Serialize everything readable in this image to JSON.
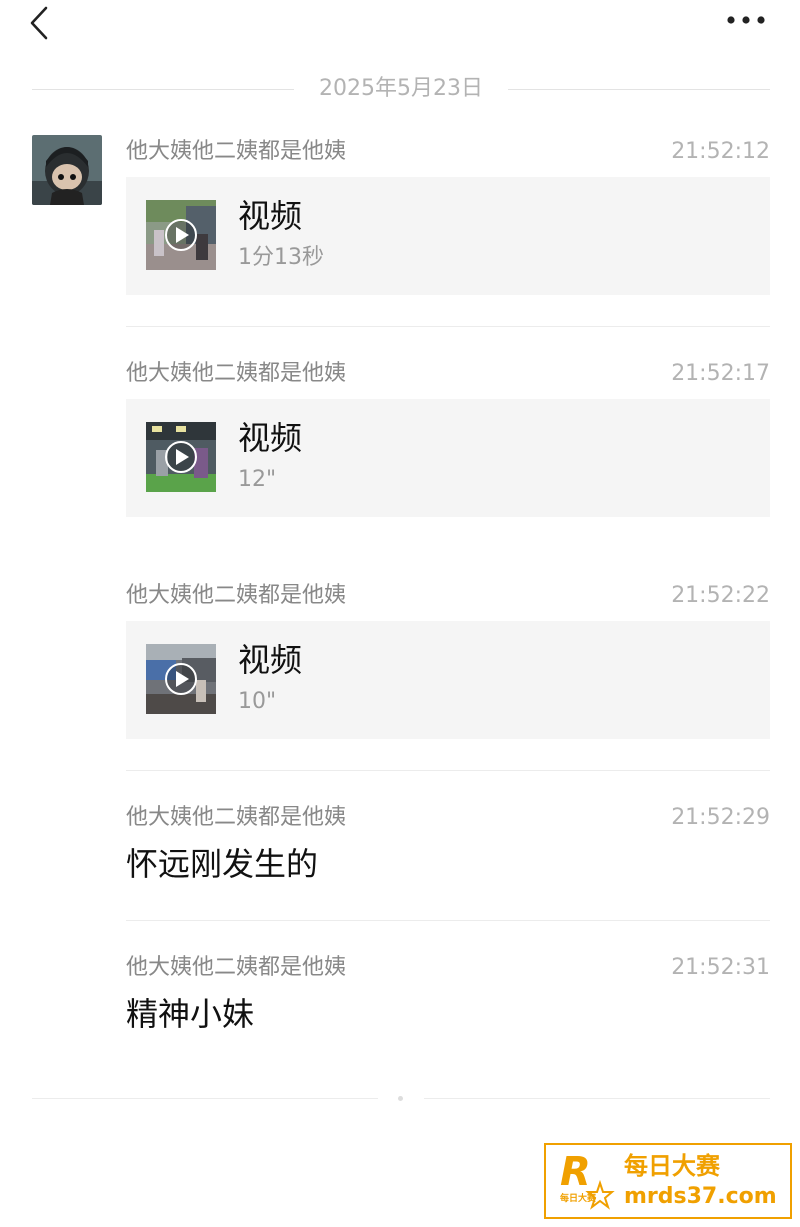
{
  "header": {
    "back_icon": "chevron-left-icon",
    "more_icon": "more-horizontal-icon"
  },
  "date_divider": "2025年5月23日",
  "messages": [
    {
      "sender": "他大姨他二姨都是他姨",
      "time": "21:52:12",
      "type": "video",
      "title": "视频",
      "duration": "1分13秒"
    },
    {
      "sender": "他大姨他二姨都是他姨",
      "time": "21:52:17",
      "type": "video",
      "title": "视频",
      "duration": "12\""
    },
    {
      "sender": "他大姨他二姨都是他姨",
      "time": "21:52:22",
      "type": "video",
      "title": "视频",
      "duration": "10\""
    },
    {
      "sender": "他大姨他二姨都是他姨",
      "time": "21:52:29",
      "type": "text",
      "text": "怀远刚发生的"
    },
    {
      "sender": "他大姨他二姨都是他姨",
      "time": "21:52:31",
      "type": "text",
      "text": "精神小妹"
    }
  ],
  "watermark": {
    "logo_letter": "R",
    "logo_small": "每日大赛",
    "name": "每日大赛",
    "url": "mrds37.com",
    "color": "#f0a000"
  },
  "colors": {
    "card_bg": "#f5f5f5",
    "meta_text": "#888888",
    "time_text": "#b3b3b3"
  }
}
